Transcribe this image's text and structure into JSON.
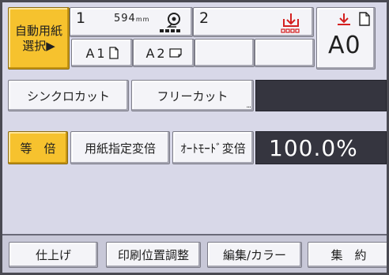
{
  "paper_select": {
    "auto_paper_button": {
      "line1": "自動用紙",
      "line2": "選択▶"
    },
    "roll1": {
      "number": "1",
      "width": "594",
      "unit": "mm"
    },
    "roll2": {
      "number": "2"
    },
    "manual_feed": {
      "size": "A0"
    },
    "size_buttons": [
      {
        "label": "A1",
        "icon": "portrait-sheet-icon"
      },
      {
        "label": "A2",
        "icon": "landscape-sheet-icon"
      },
      {
        "label": ""
      },
      {
        "label": ""
      }
    ]
  },
  "cut_mode": {
    "synchro_cut": "シンクロカット",
    "free_cut": "フリーカット",
    "free_cut_more": "..."
  },
  "zoom": {
    "full_size": "等　倍",
    "paper_specified": "用紙指定変倍",
    "auto_mode": "ｵｰﾄﾓｰﾄﾞ変倍",
    "ratio": "100.0%"
  },
  "bottom_tabs": [
    "仕上げ",
    "印刷位置調整",
    "編集/カラー",
    "集　約"
  ],
  "colors": {
    "accent_yellow": "#f6c22e",
    "background": "#d8d8e8",
    "dark_panel": "#35353f",
    "red_icon": "#d42020"
  }
}
